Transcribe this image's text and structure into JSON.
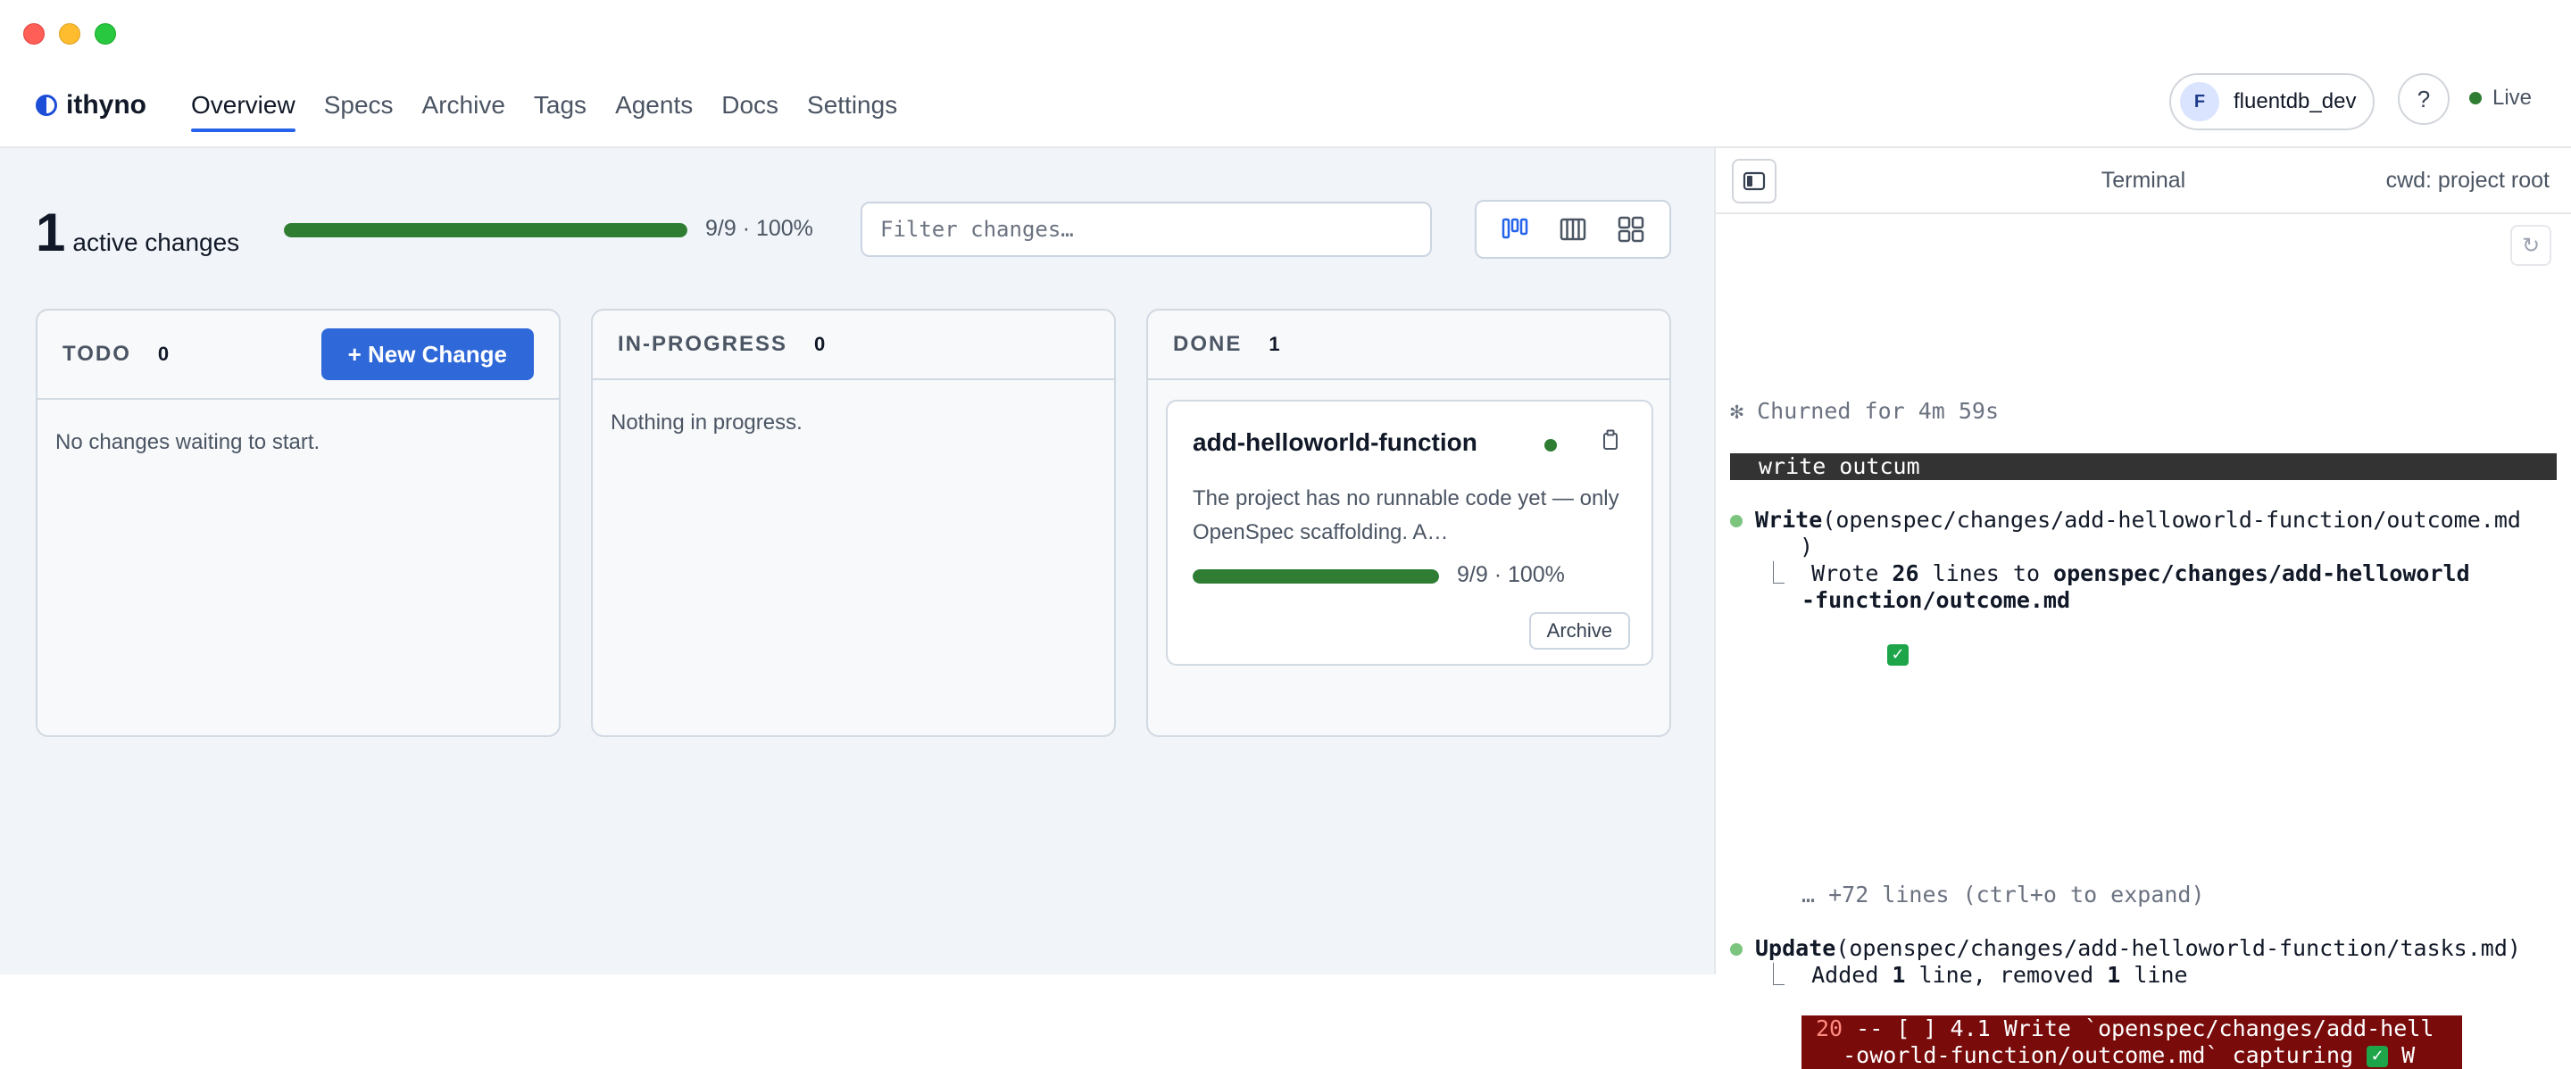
{
  "window": {
    "controls": [
      "close",
      "minimize",
      "maximize"
    ]
  },
  "brand": {
    "name": "ithyno"
  },
  "nav": {
    "items": [
      {
        "label": "Overview",
        "active": true
      },
      {
        "label": "Specs"
      },
      {
        "label": "Archive"
      },
      {
        "label": "Tags"
      },
      {
        "label": "Agents"
      },
      {
        "label": "Docs"
      },
      {
        "label": "Settings"
      }
    ]
  },
  "user": {
    "initial": "F",
    "name": "fluentdb_dev"
  },
  "help": {
    "label": "?"
  },
  "live": {
    "label": "Live",
    "color": "#2e7d32"
  },
  "summary": {
    "count": "1",
    "label": "active changes",
    "progress_fraction": 1.0,
    "progress_text": "9/9 · 100%"
  },
  "filter": {
    "placeholder": "Filter changes…",
    "value": ""
  },
  "views": [
    "board-view-icon",
    "columns-view-icon",
    "grid-view-icon"
  ],
  "columns": [
    {
      "title": "TODO",
      "count": "0",
      "action": "+ New Change",
      "empty": "No changes waiting to start."
    },
    {
      "title": "IN-PROGRESS",
      "count": "0",
      "empty": "Nothing in progress."
    },
    {
      "title": "DONE",
      "count": "1"
    }
  ],
  "card": {
    "title": "add-helloworld-function",
    "status_color": "#2e7d32",
    "description": "The project has no runnable code yet — only OpenSpec scaffolding. A…",
    "progress_fraction": 1.0,
    "progress_text": "9/9 · 100%",
    "archive_label": "Archive"
  },
  "terminal": {
    "title": "Terminal",
    "cwd": "cwd: project root",
    "churned": "✻ Churned for 4m 59s",
    "prompt": "write outcum",
    "write_tool": "Write",
    "write_args": "(openspec/changes/add-helloworld-function/outcome.md",
    "write_close": ")",
    "wrote_prefix": "Wrote ",
    "wrote_count": "26",
    "wrote_mid": " lines to ",
    "wrote_path1": "openspec/changes/add-helloworld",
    "wrote_path2": "-function/outcome.md",
    "expand_hint": "… +72 lines (ctrl+o to expand)",
    "update_tool": "Update",
    "update_args": "(openspec/changes/add-helloworld-function/tasks.md)",
    "added_prefix": "Added ",
    "added_count": "1",
    "added_mid": " line, removed ",
    "removed_count": "1",
    "added_suffix": " line",
    "diff_num": "20",
    "diff_line1": " -- [ ] 4.1 Write `openspec/changes/add-hell",
    "diff_line2": "  -oworld-function/outcome.md` capturing ",
    "diff_line2_end": " W"
  }
}
